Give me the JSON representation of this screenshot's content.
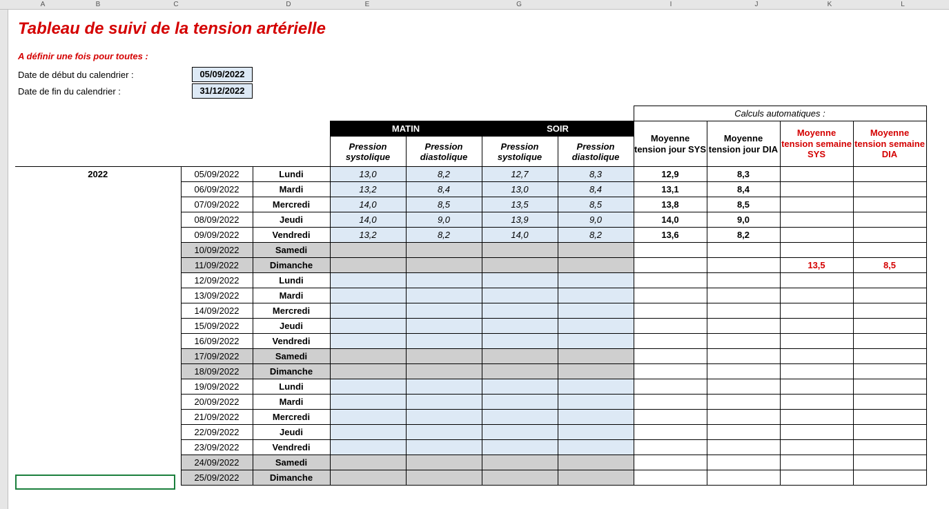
{
  "col_letters": {
    "A": 52,
    "B": 132,
    "C": 245,
    "D": 408,
    "E": 522,
    "G": 742,
    "I": 962,
    "J": 1086,
    "K": 1192,
    "L": 1298
  },
  "title": "Tableau de suivi de la tension artérielle",
  "subtitle": "A définir une fois pour toutes :",
  "params": {
    "start_label": "Date de début du calendrier :",
    "start_value": "05/09/2022",
    "end_label": "Date de fin du calendrier :",
    "end_value": "31/12/2022"
  },
  "headers": {
    "matin": "MATIN",
    "soir": "SOIR",
    "p_sys": "Pression systolique",
    "p_dia": "Pression diastolique",
    "avg_sys_day": "Moyenne tension jour SYS",
    "avg_dia_day": "Moyenne tension jour DIA",
    "avg_sys_week": "Moyenne tension semaine SYS",
    "avg_dia_week": "Moyenne tension semaine DIA",
    "calc_title": "Calculs automatiques :"
  },
  "year": "2022",
  "rows": [
    {
      "date": "05/09/2022",
      "day": "Lundi",
      "weekend": false,
      "m_sys": "13,0",
      "m_dia": "8,2",
      "s_sys": "12,7",
      "s_dia": "8,3",
      "avg_sys": "12,9",
      "avg_dia": "8,3",
      "w_sys": "",
      "w_dia": ""
    },
    {
      "date": "06/09/2022",
      "day": "Mardi",
      "weekend": false,
      "m_sys": "13,2",
      "m_dia": "8,4",
      "s_sys": "13,0",
      "s_dia": "8,4",
      "avg_sys": "13,1",
      "avg_dia": "8,4",
      "w_sys": "",
      "w_dia": ""
    },
    {
      "date": "07/09/2022",
      "day": "Mercredi",
      "weekend": false,
      "m_sys": "14,0",
      "m_dia": "8,5",
      "s_sys": "13,5",
      "s_dia": "8,5",
      "avg_sys": "13,8",
      "avg_dia": "8,5",
      "w_sys": "",
      "w_dia": ""
    },
    {
      "date": "08/09/2022",
      "day": "Jeudi",
      "weekend": false,
      "m_sys": "14,0",
      "m_dia": "9,0",
      "s_sys": "13,9",
      "s_dia": "9,0",
      "avg_sys": "14,0",
      "avg_dia": "9,0",
      "w_sys": "",
      "w_dia": ""
    },
    {
      "date": "09/09/2022",
      "day": "Vendredi",
      "weekend": false,
      "m_sys": "13,2",
      "m_dia": "8,2",
      "s_sys": "14,0",
      "s_dia": "8,2",
      "avg_sys": "13,6",
      "avg_dia": "8,2",
      "w_sys": "",
      "w_dia": ""
    },
    {
      "date": "10/09/2022",
      "day": "Samedi",
      "weekend": true,
      "m_sys": "",
      "m_dia": "",
      "s_sys": "",
      "s_dia": "",
      "avg_sys": "",
      "avg_dia": "",
      "w_sys": "",
      "w_dia": ""
    },
    {
      "date": "11/09/2022",
      "day": "Dimanche",
      "weekend": true,
      "m_sys": "",
      "m_dia": "",
      "s_sys": "",
      "s_dia": "",
      "avg_sys": "",
      "avg_dia": "",
      "w_sys": "13,5",
      "w_dia": "8,5"
    },
    {
      "date": "12/09/2022",
      "day": "Lundi",
      "weekend": false,
      "m_sys": "",
      "m_dia": "",
      "s_sys": "",
      "s_dia": "",
      "avg_sys": "",
      "avg_dia": "",
      "w_sys": "",
      "w_dia": ""
    },
    {
      "date": "13/09/2022",
      "day": "Mardi",
      "weekend": false,
      "m_sys": "",
      "m_dia": "",
      "s_sys": "",
      "s_dia": "",
      "avg_sys": "",
      "avg_dia": "",
      "w_sys": "",
      "w_dia": ""
    },
    {
      "date": "14/09/2022",
      "day": "Mercredi",
      "weekend": false,
      "m_sys": "",
      "m_dia": "",
      "s_sys": "",
      "s_dia": "",
      "avg_sys": "",
      "avg_dia": "",
      "w_sys": "",
      "w_dia": ""
    },
    {
      "date": "15/09/2022",
      "day": "Jeudi",
      "weekend": false,
      "m_sys": "",
      "m_dia": "",
      "s_sys": "",
      "s_dia": "",
      "avg_sys": "",
      "avg_dia": "",
      "w_sys": "",
      "w_dia": ""
    },
    {
      "date": "16/09/2022",
      "day": "Vendredi",
      "weekend": false,
      "m_sys": "",
      "m_dia": "",
      "s_sys": "",
      "s_dia": "",
      "avg_sys": "",
      "avg_dia": "",
      "w_sys": "",
      "w_dia": ""
    },
    {
      "date": "17/09/2022",
      "day": "Samedi",
      "weekend": true,
      "m_sys": "",
      "m_dia": "",
      "s_sys": "",
      "s_dia": "",
      "avg_sys": "",
      "avg_dia": "",
      "w_sys": "",
      "w_dia": ""
    },
    {
      "date": "18/09/2022",
      "day": "Dimanche",
      "weekend": true,
      "m_sys": "",
      "m_dia": "",
      "s_sys": "",
      "s_dia": "",
      "avg_sys": "",
      "avg_dia": "",
      "w_sys": "",
      "w_dia": ""
    },
    {
      "date": "19/09/2022",
      "day": "Lundi",
      "weekend": false,
      "m_sys": "",
      "m_dia": "",
      "s_sys": "",
      "s_dia": "",
      "avg_sys": "",
      "avg_dia": "",
      "w_sys": "",
      "w_dia": ""
    },
    {
      "date": "20/09/2022",
      "day": "Mardi",
      "weekend": false,
      "m_sys": "",
      "m_dia": "",
      "s_sys": "",
      "s_dia": "",
      "avg_sys": "",
      "avg_dia": "",
      "w_sys": "",
      "w_dia": ""
    },
    {
      "date": "21/09/2022",
      "day": "Mercredi",
      "weekend": false,
      "m_sys": "",
      "m_dia": "",
      "s_sys": "",
      "s_dia": "",
      "avg_sys": "",
      "avg_dia": "",
      "w_sys": "",
      "w_dia": ""
    },
    {
      "date": "22/09/2022",
      "day": "Jeudi",
      "weekend": false,
      "m_sys": "",
      "m_dia": "",
      "s_sys": "",
      "s_dia": "",
      "avg_sys": "",
      "avg_dia": "",
      "w_sys": "",
      "w_dia": ""
    },
    {
      "date": "23/09/2022",
      "day": "Vendredi",
      "weekend": false,
      "m_sys": "",
      "m_dia": "",
      "s_sys": "",
      "s_dia": "",
      "avg_sys": "",
      "avg_dia": "",
      "w_sys": "",
      "w_dia": ""
    },
    {
      "date": "24/09/2022",
      "day": "Samedi",
      "weekend": true,
      "m_sys": "",
      "m_dia": "",
      "s_sys": "",
      "s_dia": "",
      "avg_sys": "",
      "avg_dia": "",
      "w_sys": "",
      "w_dia": ""
    },
    {
      "date": "25/09/2022",
      "day": "Dimanche",
      "weekend": true,
      "m_sys": "",
      "m_dia": "",
      "s_sys": "",
      "s_dia": "",
      "avg_sys": "",
      "avg_dia": "",
      "w_sys": "",
      "w_dia": ""
    }
  ]
}
